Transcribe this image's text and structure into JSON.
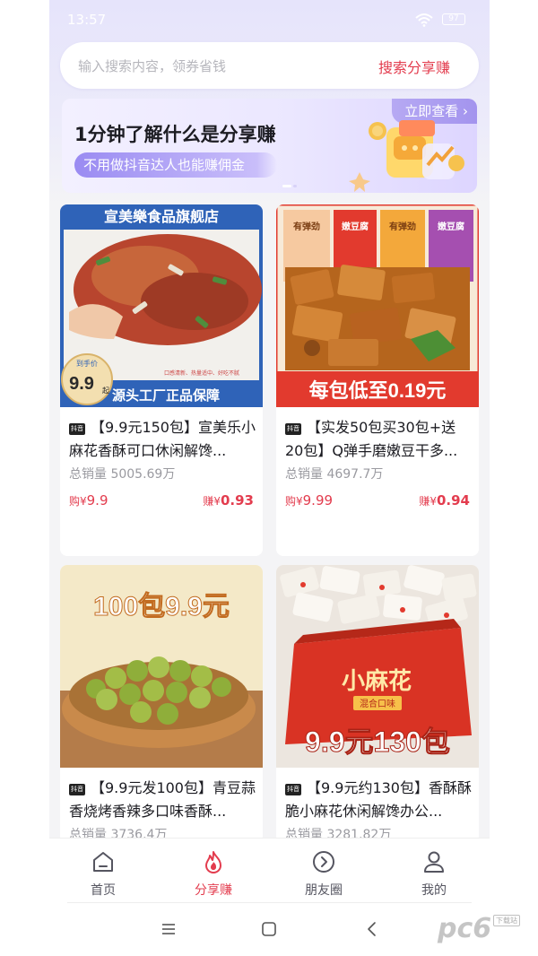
{
  "status_bar": {
    "time": "13:57",
    "battery": "97"
  },
  "search": {
    "placeholder": "输入搜索内容，领券省钱",
    "button": "搜索分享赚"
  },
  "banner": {
    "title": "1分钟了解什么是分享赚",
    "subtitle": "不用做抖音达人也能赚佣金",
    "view_button": "立即查看 ›"
  },
  "products": [
    {
      "platform": "抖音",
      "store_title": "宣美樂食品旗舰店",
      "badge_top": "到手价",
      "badge_price": "9.9",
      "badge_suffix": "起",
      "strip_text": "源头工厂正品保障",
      "small_caption": "口感清新、热量适中、好吃不腻",
      "name": "【9.9元150包】宣美乐小麻花香酥可口休闲解馋...",
      "sales": "总销量 5005.69万",
      "price_prefix": "购¥",
      "price": "9.9",
      "earn_prefix": "赚¥",
      "earn": "0.93"
    },
    {
      "platform": "抖音",
      "packet_labels": [
        "有弹劲",
        "嫩豆腐",
        "有弹劲",
        "嫩豆腐"
      ],
      "banner_text": "每包低至0.19元",
      "name": "【实发50包买30包+送20包】Q弹手磨嫩豆干多...",
      "sales": "总销量 4697.7万",
      "price_prefix": "购¥",
      "price": "9.99",
      "earn_prefix": "赚¥",
      "earn": "0.94"
    },
    {
      "platform": "抖音",
      "overlay_text": "100包9.9元",
      "name": "【9.9元发100包】青豆蒜香烧烤香辣多口味香酥...",
      "sales": "总销量 3736.4万"
    },
    {
      "platform": "抖音",
      "box_text": "小麻花",
      "box_subtext": "混合口味",
      "overlay_text": "9.9元130包",
      "name": "【9.9元约130包】香酥酥脆小麻花休闲解馋办公...",
      "sales": "总销量 3281.82万"
    }
  ],
  "nav": [
    {
      "label": "首页",
      "icon": "home-icon",
      "active": false
    },
    {
      "label": "分享赚",
      "icon": "flame-icon",
      "active": true
    },
    {
      "label": "朋友圈",
      "icon": "moments-icon",
      "active": false
    },
    {
      "label": "我的",
      "icon": "profile-icon",
      "active": false
    }
  ],
  "watermark": {
    "text": "pc6",
    "small": "下载站"
  },
  "colors": {
    "accent": "#e33c4e",
    "banner_purple": "#9a8bf2",
    "store_blue": "#2f63b8"
  }
}
